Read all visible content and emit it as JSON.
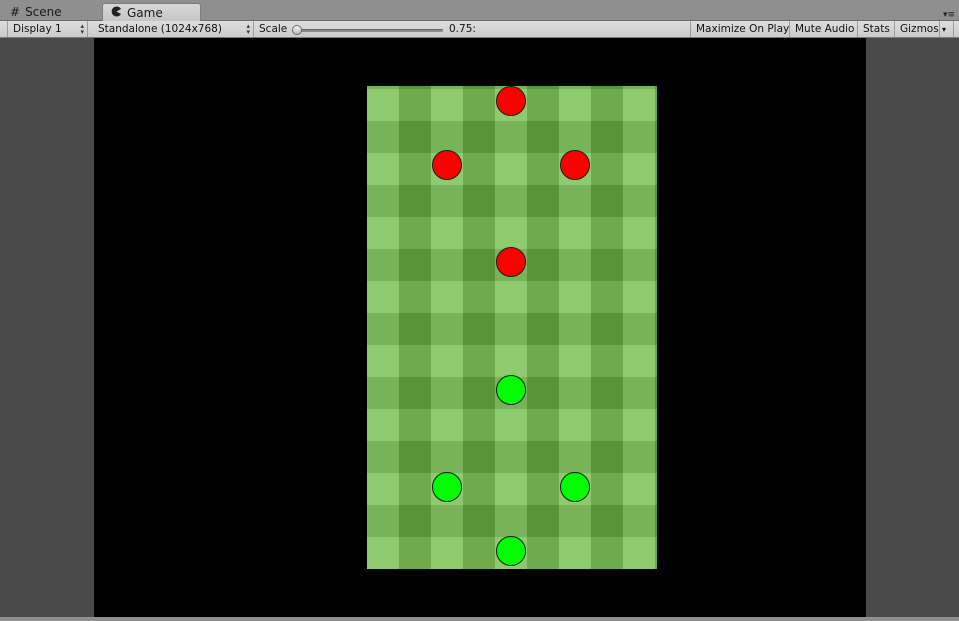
{
  "tabs": [
    {
      "label": "Scene",
      "icon": "grid-icon",
      "active": false
    },
    {
      "label": "Game",
      "icon": "pacman-icon",
      "active": true
    }
  ],
  "toolbar": {
    "display": "Display 1",
    "resolution": "Standalone (1024x768)",
    "scale_label": "Scale",
    "scale_value": "0.75:",
    "maximize": "Maximize On Play",
    "mute": "Mute Audio",
    "stats": "Stats",
    "gizmos": "Gizmos"
  },
  "game": {
    "pitch_color": "#6fbb47",
    "letterbox_color": "#000000",
    "red_team_color": "#ff0000",
    "green_team_color": "#00ff00"
  }
}
